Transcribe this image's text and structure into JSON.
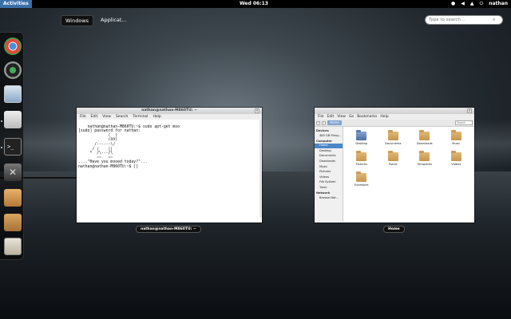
{
  "topbar": {
    "activities_label": "Activities",
    "clock": "Wed 06:13",
    "user": "nathan",
    "tray_icons": [
      "accessibility-icon",
      "volume-icon",
      "network-icon",
      "power-icon"
    ]
  },
  "overview": {
    "tabs": [
      {
        "label": "Windows"
      },
      {
        "label": "Applicat..."
      }
    ],
    "search_placeholder": "Type to search..."
  },
  "dash": {
    "items": [
      "chrome-icon",
      "webcam-icon",
      "document-viewer-icon",
      "files-icon",
      "terminal-icon",
      "settings-icon",
      "software-center-icon",
      "archive-icon",
      "calculator-icon"
    ]
  },
  "terminal": {
    "title": "nathan@nathan-M860TU: ~",
    "caption": "nathan@nathan-M860TU: ~",
    "menu": [
      "File",
      "Edit",
      "View",
      "Search",
      "Terminal",
      "Help"
    ],
    "lines": "nathan@nathan-M860TU:~$ sudo apt-get moo\n[sudo] password for nathan:\n             (__)\n             (oo)\n       /------\\/\n      / |    ||\n     *  /\\---/\\\n        ~~   ~~\n....\"Have you mooed today?\"...\nnathan@nathan-M860TU:~$ []"
  },
  "filemanager": {
    "caption": "Home",
    "menu": [
      "File",
      "Edit",
      "View",
      "Go",
      "Bookmarks",
      "Help"
    ],
    "path": "Home",
    "search_placeholder": "Search",
    "sidebar": {
      "devices_header": "Devices",
      "devices": [
        "480 GB Filesy..."
      ],
      "computer_header": "Computer",
      "computer": [
        "Home",
        "Desktop",
        "Documents",
        "Downloads",
        "Music",
        "Pictures",
        "Videos",
        "File System",
        "Trash"
      ],
      "network_header": "Network",
      "network": [
        "Browse Net..."
      ]
    },
    "files": [
      {
        "name": "Desktop",
        "kind": "desktop"
      },
      {
        "name": "Documents",
        "kind": "folder"
      },
      {
        "name": "Downloads",
        "kind": "folder"
      },
      {
        "name": "Music",
        "kind": "folder"
      },
      {
        "name": "Pictures",
        "kind": "folder"
      },
      {
        "name": "Public",
        "kind": "folder"
      },
      {
        "name": "Templates",
        "kind": "folder"
      },
      {
        "name": "Videos",
        "kind": "folder"
      },
      {
        "name": "Examples",
        "kind": "folder"
      }
    ]
  }
}
